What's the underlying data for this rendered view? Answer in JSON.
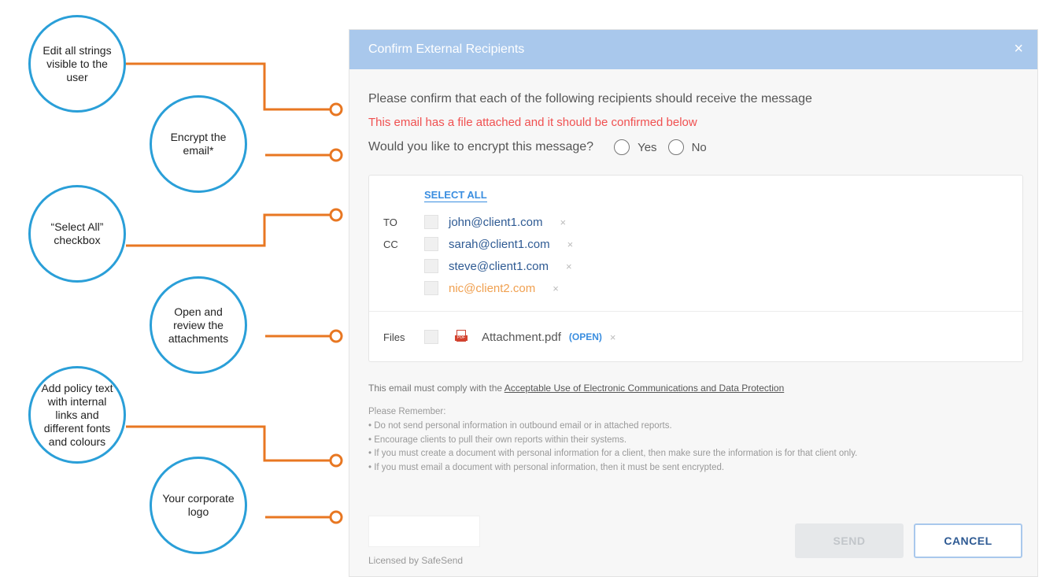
{
  "callouts": [
    "Edit all strings visible to the user",
    "Encrypt the email*",
    "“Select All” checkbox",
    "Open and review the attachments",
    "Add policy text with internal links and different fonts and colours",
    "Your corporate logo"
  ],
  "dialog": {
    "title": "Confirm External Recipients",
    "close_icon": "×",
    "confirm_text": "Please confirm that each of the following recipients should receive the message",
    "warning_text": "This email has a file attached and it should be confirmed below",
    "encrypt_question": "Would you like to encrypt this message?",
    "encrypt_options": [
      "Yes",
      "No"
    ],
    "select_all": "SELECT ALL",
    "recipients": [
      {
        "type": "TO",
        "email": "john@client1.com",
        "external": false
      },
      {
        "type": "CC",
        "email": "sarah@client1.com",
        "external": false
      },
      {
        "type": "",
        "email": "steve@client1.com",
        "external": false
      },
      {
        "type": "",
        "email": "nic@client2.com",
        "external": true
      }
    ],
    "remove_glyph": "×",
    "files_label": "Files",
    "attachment_name": "Attachment.pdf",
    "pdf_tag": "PDF",
    "open_label": "(OPEN)",
    "policy_prefix": "This email must comply with the ",
    "policy_link": "Acceptable Use of Electronic Communications and Data Protection",
    "remember_title": "Please Remember:",
    "bullets": [
      "• Do not send personal information in outbound email or in attached reports.",
      "• Encourage clients to pull their own reports within their systems.",
      "• If you must create a document with personal information for a client, then make sure the information is for that client only.",
      "• If you must email a document with personal information, then it must be sent encrypted."
    ],
    "licensed_by": "Licensed by SafeSend",
    "send_label": "SEND",
    "cancel_label": "CANCEL"
  },
  "colors": {
    "header": "#a9c8ec",
    "callout_border": "#2a9fd8",
    "connector": "#e87722",
    "warning": "#f05050",
    "external_recipient": "#f0a050",
    "link": "#3a8ee0"
  }
}
